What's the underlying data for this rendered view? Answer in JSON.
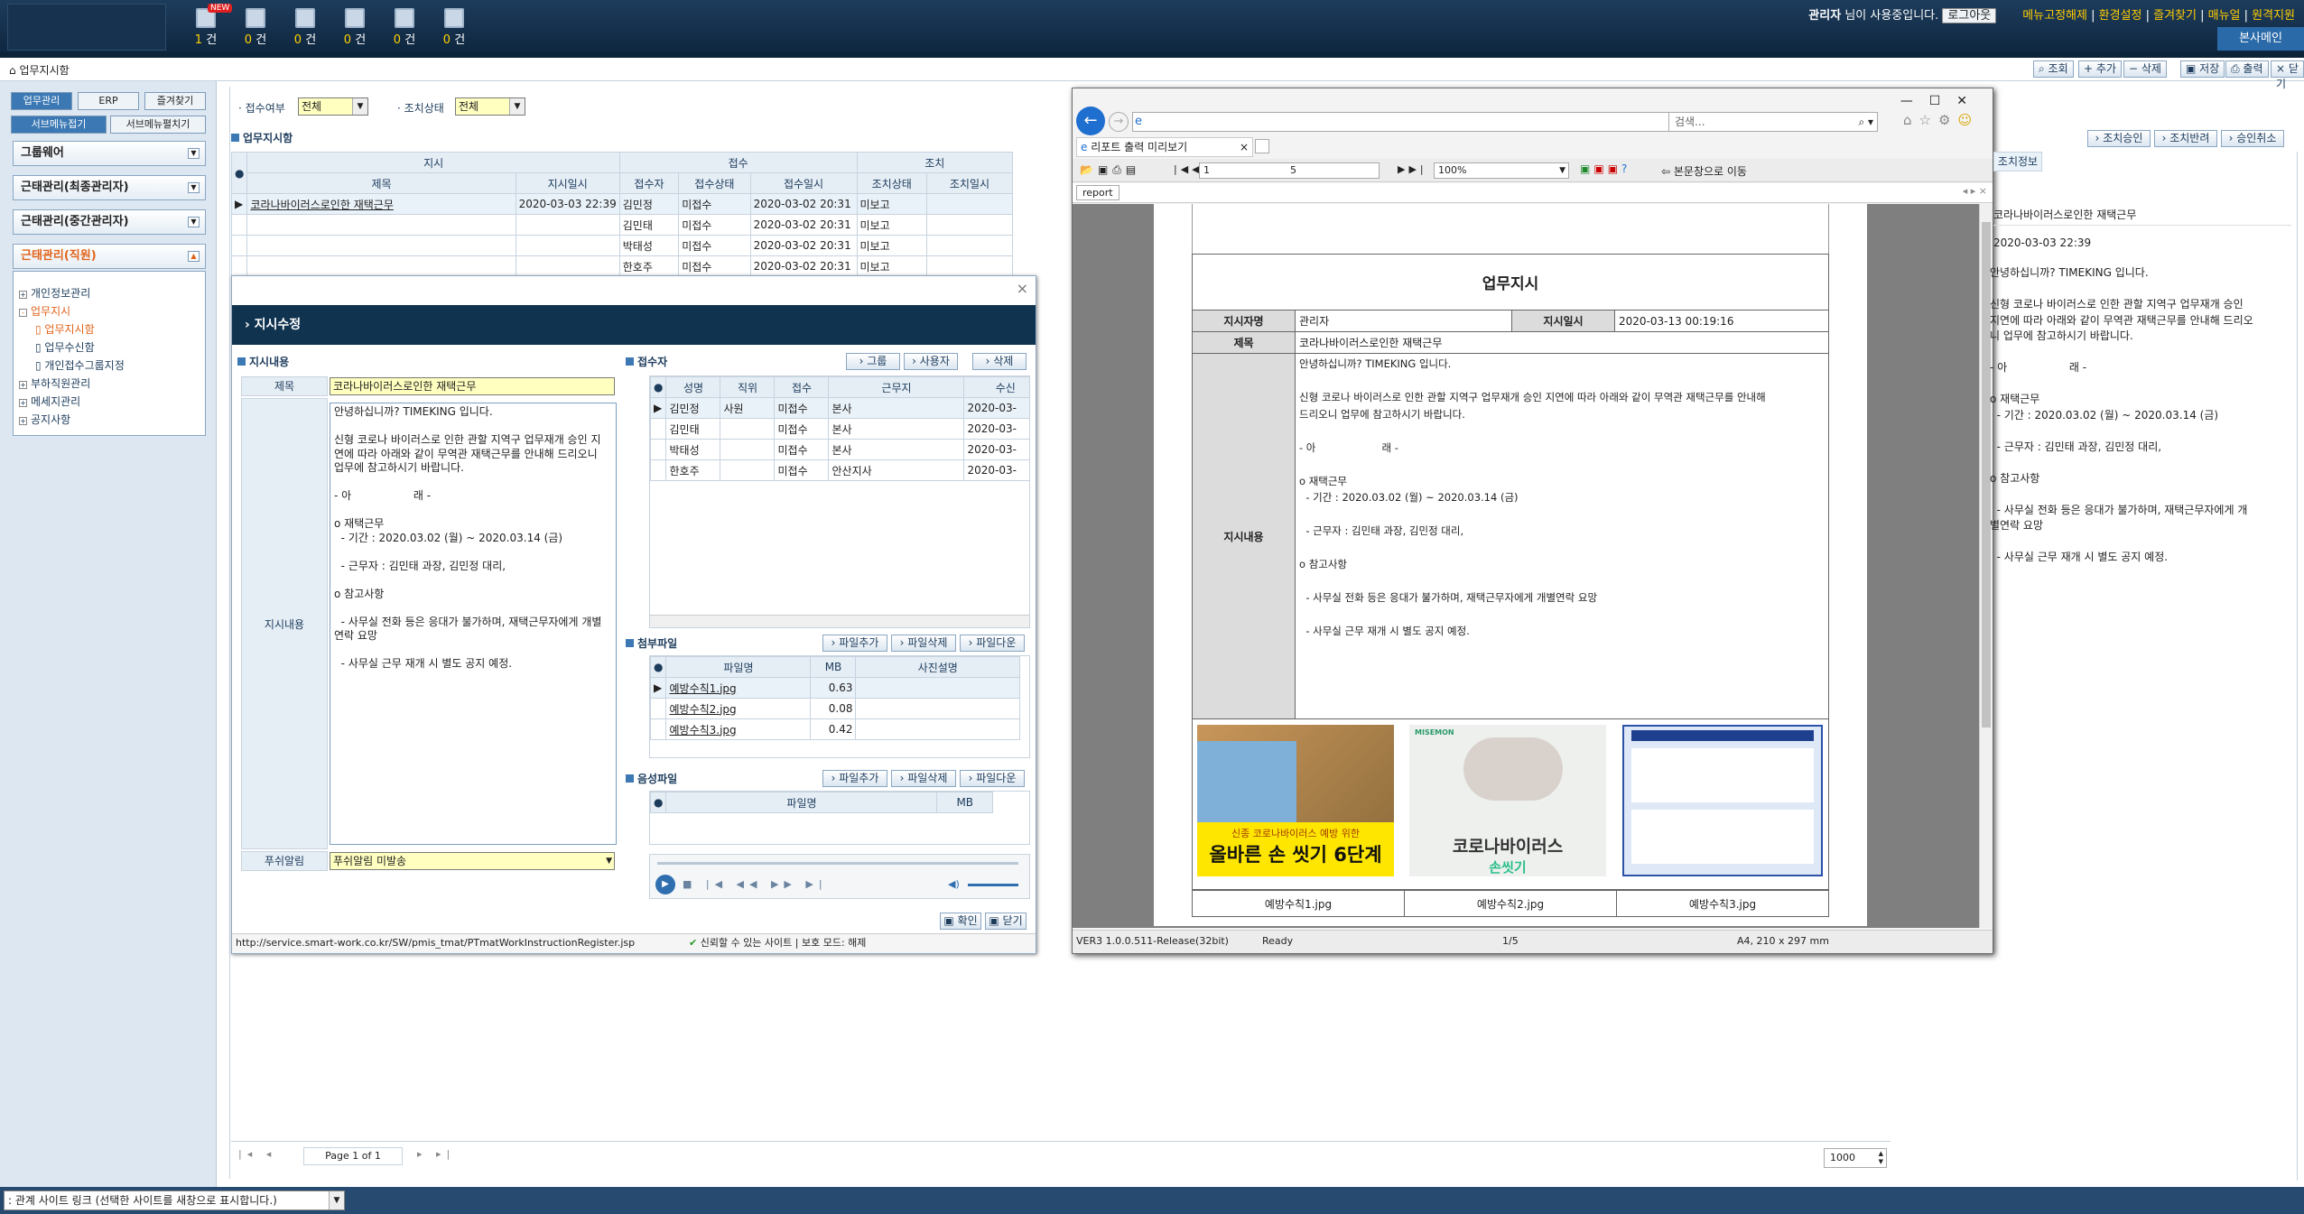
{
  "topbar": {
    "icons": [
      {
        "count": "1",
        "unit": "건",
        "new": "NEW"
      },
      {
        "count": "0",
        "unit": "건"
      },
      {
        "count": "0",
        "unit": "건"
      },
      {
        "count": "0",
        "unit": "건"
      },
      {
        "count": "0",
        "unit": "건"
      },
      {
        "count": "0",
        "unit": "건"
      }
    ],
    "user": "관리자",
    "user_msg": " 님이 사용중입니다.",
    "logout": "로그아웃",
    "links": [
      "메뉴고정해제",
      "환경설정",
      "즐겨찾기",
      "매뉴얼",
      "원격지원"
    ],
    "hq": "본사메인"
  },
  "breadcrumb": "업무지시함",
  "toolbar": [
    "조회",
    "추가",
    "삭제",
    "저장",
    "출력",
    "닫기"
  ],
  "sidebar": {
    "tabs": [
      "업무관리",
      "ERP",
      "즐겨찾기"
    ],
    "submenu": [
      "서브메뉴접기",
      "서브메뉴펼치기"
    ],
    "groups": [
      "그룹웨어",
      "근태관리(최종관리자)",
      "근태관리(중간관리자)",
      "근태관리(직원)"
    ],
    "tree": [
      {
        "label": "개인정보관리",
        "box": "+"
      },
      {
        "label": "업무지시",
        "box": "-"
      },
      {
        "label": "업무지시함"
      },
      {
        "label": "업무수신함"
      },
      {
        "label": "개인접수그룹지정"
      },
      {
        "label": "부하직원관리",
        "box": "+"
      },
      {
        "label": "메세지관리",
        "box": "+"
      },
      {
        "label": "공지사항",
        "box": "+"
      }
    ]
  },
  "filter": {
    "receipt_label": "접수여부",
    "receipt_value": "전체",
    "action_label": "조치상태",
    "action_value": "전체"
  },
  "list": {
    "section": "업무지시함",
    "groups": [
      "지시",
      "접수",
      "조치"
    ],
    "headers": [
      "제목",
      "지시일시",
      "접수자",
      "접수상태",
      "접수일시",
      "조치상태",
      "조치일시"
    ],
    "rows": [
      [
        "코라나바이러스로인한 재택근무",
        "2020-03-03 22:39",
        "김민정",
        "미접수",
        "2020-03-02 20:31",
        "미보고",
        ""
      ],
      [
        "",
        "",
        "김민태",
        "미접수",
        "2020-03-02 20:31",
        "미보고",
        ""
      ],
      [
        "",
        "",
        "박태성",
        "미접수",
        "2020-03-02 20:31",
        "미보고",
        ""
      ],
      [
        "",
        "",
        "한호주",
        "미접수",
        "2020-03-02 20:31",
        "미보고",
        ""
      ]
    ]
  },
  "dialog": {
    "title": "지시수정",
    "content_section": "지시내용",
    "subject_label": "제목",
    "subject": "코라나바이러스로인한 재택근무",
    "content_label": "지시내용",
    "content": "안녕하십니까? TIMEKING 입니다.\n\n신형 코로나 바이러스로 인한 관할 지역구 업무재개 승인 지연에 따라 아래와 같이 무역관 재택근무를 안내해 드리오니 업무에 참고하시기 바랍니다.\n\n- 아                  래 -\n\no 재택근무\n  - 기간 : 2020.03.02 (월) ~ 2020.03.14 (금)\n\n  - 근무자 : 김민태 과장, 김민정 대리,\n\no 참고사항\n\n  - 사무실 전화 등은 응대가 불가하며, 재택근무자에게 개별연락 요망\n\n  - 사무실 근무 재개 시 별도 공지 예정.",
    "notify_label": "푸쉬알림",
    "notify_value": "푸쉬알림 미발송",
    "recv_section": "접수자",
    "recv_btns": [
      "그룹",
      "사용자",
      "삭제"
    ],
    "recv_headers": [
      "성명",
      "직위",
      "접수",
      "근무지",
      "수신"
    ],
    "recv_rows": [
      [
        "김민정",
        "사원",
        "미접수",
        "본사",
        "2020-03-"
      ],
      [
        "김민태",
        "",
        "미접수",
        "본사",
        "2020-03-"
      ],
      [
        "박태성",
        "",
        "미접수",
        "본사",
        "2020-03-"
      ],
      [
        "한호주",
        "",
        "미접수",
        "안산지사",
        "2020-03-"
      ]
    ],
    "file_section": "첨부파일",
    "file_btns": [
      "파일추가",
      "파일삭제",
      "파일다운"
    ],
    "file_headers": [
      "파일명",
      "MB",
      "사진설명"
    ],
    "files": [
      [
        "예방수칙1.jpg",
        "0.63"
      ],
      [
        "예방수칙2.jpg",
        "0.08"
      ],
      [
        "예방수칙3.jpg",
        "0.42"
      ]
    ],
    "audio_section": "음성파일",
    "audio_btns": [
      "파일추가",
      "파일삭제",
      "파일다운"
    ],
    "audio_headers": [
      "파일명",
      "MB"
    ],
    "ok": "확인",
    "close": "닫기",
    "status_url": "http://service.smart-work.co.kr/SW/pmis_tmat/PTmatWorkInstructionRegister.jsp",
    "status_trust": "신뢰할 수 있는 사이트 | 보호 모드: 해제"
  },
  "ie": {
    "search_placeholder": "검색...",
    "tab": "리포트 출력 미리보기",
    "page_cur": "1",
    "page_total": "5",
    "zoom": "100%",
    "main_link": "본문창으로 이동",
    "report_tab": "report",
    "report": {
      "title": "업무지시",
      "author_label": "지시자명",
      "author": "관리자",
      "date_label": "지시일시",
      "date": "2020-03-13 00:19:16",
      "subject_label": "제목",
      "subject": "코라나바이러스로인한 재택근무",
      "content_label": "지시내용",
      "content": "안녕하십니까? TIMEKING 입니다.\n\n신형 코로나 바이러스로 인한 관할 지역구 업무재개 승인 지연에 따라 아래와 같이 무역관 재택근무를 안내해\n드리오니 업무에 참고하시기 바랍니다.\n\n- 아                    래 -\n\no 재택근무\n  - 기간 : 2020.03.02 (월) ~ 2020.03.14 (금)\n\n  - 근무자 : 김민태 과장, 김민정 대리,\n\no 참고사항\n\n  - 사무실 전화 등은 응대가 불가하며, 재택근무자에게 개별연락 요망\n\n  - 사무실 근무 재개 시 별도 공지 예정.",
      "img1_small": "신종 코로나바이러스 예방 위한",
      "img1_big": "올바른 손 씻기 6단계",
      "img2_small": "MISEMON",
      "img2_big1": "코로나바이러스",
      "img2_big2": "손씻기",
      "captions": [
        "예방수칙1.jpg",
        "예방수칙2.jpg",
        "예방수칙3.jpg"
      ]
    },
    "status_ver": "VER3 1.0.0.511-Release(32bit)",
    "status_ready": "Ready",
    "status_page": "1/5",
    "status_paper": "A4, 210 x 297 mm"
  },
  "right": {
    "btns": [
      "조치승인",
      "조치반려",
      "승인취소"
    ],
    "tab": "조치정보",
    "subject": "코라나바이러스로인한 재택근무",
    "date": "2020-03-03 22:39",
    "content": "안녕하십니까? TIMEKING 입니다.\n\n신형 코로나 바이러스로 인한 관할 지역구 업무재개 승인\n지연에 따라 아래와 같이 무역관 재택근무를 안내해 드리오\n니 업무에 참고하시기 바랍니다.\n\n- 아                  래 -\n\no 재택근무\n  - 기간 : 2020.03.02 (월) ~ 2020.03.14 (금)\n\n  - 근무자 : 김민태 과장, 김민정 대리,\n\no 참고사항\n\n  - 사무실 전화 등은 응대가 불가하며, 재택근무자에게 개\n별연락 요망\n\n  - 사무실 근무 재개 시 별도 공지 예정."
  },
  "pager": {
    "text": "Page 1 of 1",
    "rows": "1000"
  },
  "bottom": {
    "related": ": 관계 사이트 링크 (선택한 사이트를 새창으로 표시합니다.)"
  }
}
